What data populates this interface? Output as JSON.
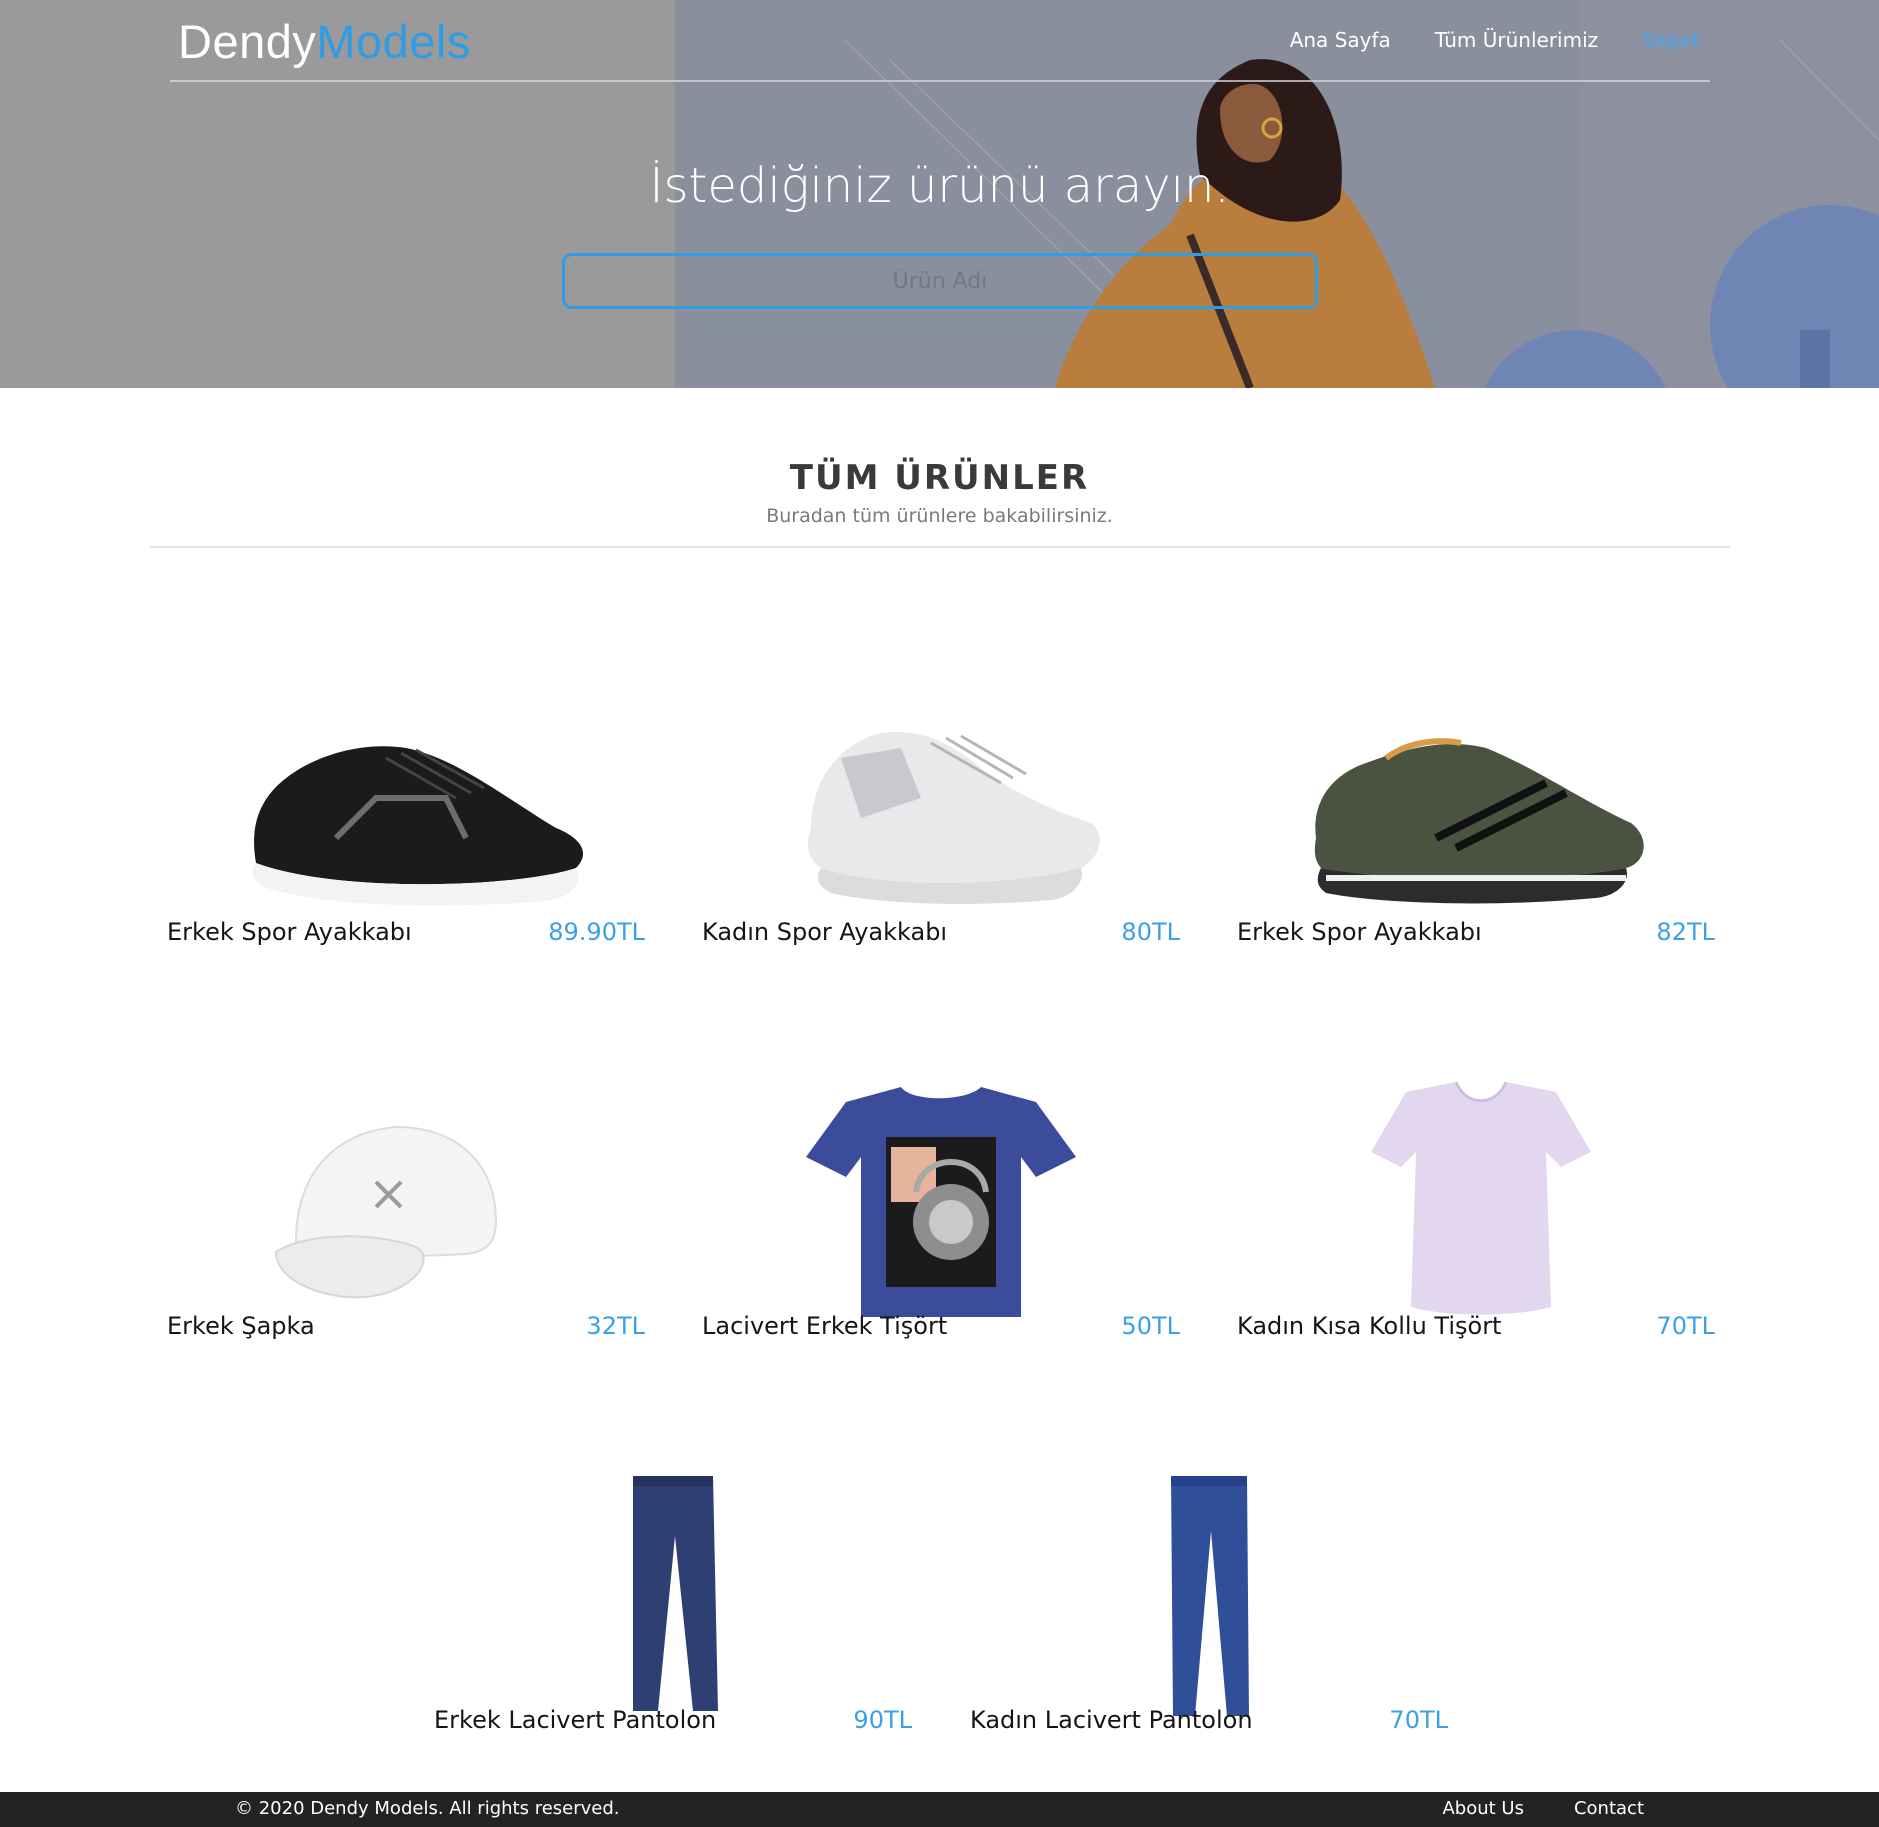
{
  "logo": {
    "part1": "Dendy",
    "part2": "Models"
  },
  "nav": {
    "items": [
      {
        "label": "Ana Sayfa",
        "active": false
      },
      {
        "label": "Tüm Ürünlerimiz",
        "active": false
      },
      {
        "label": "Sepet",
        "active": true
      }
    ]
  },
  "hero": {
    "title": "İstediğiniz ürünü arayın.",
    "search_placeholder": "Ürün Adı",
    "search_value": ""
  },
  "section": {
    "title": "TÜM ÜRÜNLER",
    "subtitle": "Buradan tüm ürünlere bakabilirsiniz."
  },
  "products": [
    {
      "name": "Erkek Spor Ayakkabı",
      "price": "89.90TL",
      "image_icon": "black-sneaker-image"
    },
    {
      "name": "Kadın Spor Ayakkabı",
      "price": "80TL",
      "image_icon": "white-sneaker-image"
    },
    {
      "name": "Erkek Spor Ayakkabı",
      "price": "82TL",
      "image_icon": "khaki-sneaker-image"
    },
    {
      "name": "Erkek Şapka",
      "price": "32TL",
      "image_icon": "white-cap-image"
    },
    {
      "name": "Lacivert Erkek Tişört",
      "price": "50TL",
      "image_icon": "navy-tshirt-image"
    },
    {
      "name": "Kadın Kısa Kollu Tişört",
      "price": "70TL",
      "image_icon": "lilac-tshirt-image"
    },
    {
      "name": "Erkek Lacivert Pantolon",
      "price": "90TL",
      "image_icon": "navy-trousers-image"
    },
    {
      "name": "Kadın Lacivert Pantolon",
      "price": "70TL",
      "image_icon": "blue-jeans-image"
    }
  ],
  "footer": {
    "copyright": "© 2020 Dendy Models. All rights reserved.",
    "links": [
      "About Us",
      "Contact"
    ]
  },
  "colors": {
    "accent": "#2f9ce6",
    "price": "#3aa0e8",
    "footer_bg": "#232323",
    "hero_overlay": "#9b9b9b"
  }
}
